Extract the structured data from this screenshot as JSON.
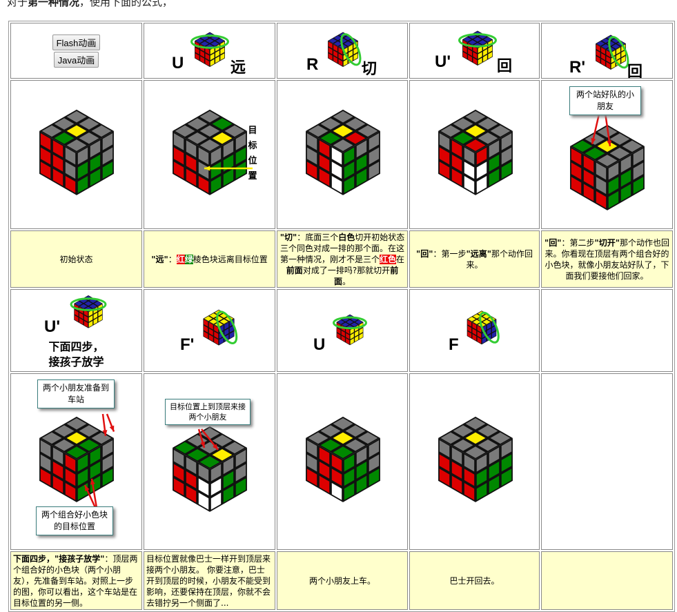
{
  "intro": {
    "prefix": "对于",
    "bold": "第一种情况",
    "suffix": "，使用下面的公式，"
  },
  "buttons": {
    "flash": "Flash动画",
    "java": "Java动画"
  },
  "moves_row1": [
    {
      "notation": "U",
      "label": "远"
    },
    {
      "notation": "R",
      "label": "切"
    },
    {
      "notation": "U'",
      "label": "回"
    },
    {
      "notation": "R'",
      "label": "回"
    }
  ],
  "moves_row4": {
    "first": {
      "notation": "U'",
      "title_line1": "下面四步，",
      "title_line2": "接孩子放学"
    },
    "others": [
      {
        "notation": "F'"
      },
      {
        "notation": "U"
      },
      {
        "notation": "F"
      }
    ]
  },
  "target_label": "目标位置",
  "callouts": {
    "kids_lined_up": "两个站好队的小朋友",
    "kids_to_station": "两个小朋友准备到车站",
    "target_of_pair": "两个组合好小色块的目标位置",
    "target_up": "目标位置上到顶层来接两个小朋友"
  },
  "captions_row3": [
    [
      {
        "t": "初始状态"
      }
    ],
    [
      {
        "t": "\"远\"",
        "b": 1
      },
      {
        "t": "："
      },
      {
        "t": "红",
        "hl": "r"
      },
      {
        "t": "绿",
        "hl": "g"
      },
      {
        "t": "棱色块远离目标位置"
      }
    ],
    [
      {
        "t": "\"切\"",
        "b": 1
      },
      {
        "t": "：底面三个"
      },
      {
        "t": "白色",
        "b": 1
      },
      {
        "t": "切开初始状态三个同色对成一排的那个面。在这第一种情况，刚才不是三个"
      },
      {
        "t": "红色",
        "hl": "r"
      },
      {
        "t": "在"
      },
      {
        "t": "前面",
        "b": 1
      },
      {
        "t": "对成了一排吗?那就切开"
      },
      {
        "t": "前面",
        "b": 1
      },
      {
        "t": "。"
      }
    ],
    [
      {
        "t": "\"回\"",
        "b": 1
      },
      {
        "t": "：第一步"
      },
      {
        "t": "\"远离\"",
        "b": 1
      },
      {
        "t": "那个动作回来。"
      }
    ],
    [
      {
        "t": "\"回\"",
        "b": 1
      },
      {
        "t": "：第二步"
      },
      {
        "t": "\"切开\"",
        "b": 1
      },
      {
        "t": "那个动作也回来。你看现在顶层有两个组合好的小色块，就像小朋友站好队了，下面我们要接他们回家。"
      }
    ]
  ],
  "captions_row6": [
    [
      {
        "t": "下面四步，\"接孩子放学\"",
        "b": 1
      },
      {
        "t": "：顶层两个组合好的小色块（两个小朋友），先准备到车站。对照上一步的图，你可以看出，这个车站是在目标位置的另一侧。"
      }
    ],
    [
      {
        "t": "目标位置就像巴士一样开到顶层来接两个小朋友。 你要注意，巴士开到顶层的时候，小朋友不能受到影响，还要保持在顶层，你就不会去错拧另一个侧面了..."
      }
    ],
    [
      {
        "t": "两个小朋友上车。"
      }
    ],
    [
      {
        "t": "巴士开回去。"
      }
    ],
    []
  ],
  "colors": {
    "g": "#7a7a7a",
    "Y": "#ffee00",
    "R": "#dd0000",
    "G": "#008800",
    "W": "#ffffff",
    "B": "#2222aa",
    "O": "#ff8800",
    "caption_bg": "#ffffcc",
    "arrow_green": "#33cc33"
  },
  "cubes": {
    "r2c1": {
      "top": "ggggYggGg",
      "left": "RRgRRgRRR",
      "right": "gggGGgGGG"
    },
    "r2c2": {
      "top": "gGgggYggg",
      "left": "gggRRgRRR",
      "right": "gggGGGGGG"
    },
    "r2c3": {
      "top": "ggggYRgGg",
      "left": "gRWgRWRRW",
      "right": "GggGGgGGg"
    },
    "r2c4": {
      "top": "ggggYggGR",
      "left": "gRgRRWRRW",
      "right": "RggWGgWGG"
    },
    "r2c5": {
      "top": "ggggYgGGg",
      "left": "RRgRRgRRR",
      "right": "gggGGgGGG"
    },
    "r5c1": {
      "top": "ggggYGggG",
      "left": "ggRgRRRRR",
      "right": "GGgGGgGGG"
    },
    "r5c2": {
      "top": "gggggYGGG",
      "left": "gggRRWRRW",
      "right": "gggWGgWGG"
    },
    "r5c3": {
      "top": "ggggYggGG",
      "left": "gRRgRRRRW",
      "right": "GggGGgGGG"
    },
    "r5c4": {
      "top": "ggggYgggg",
      "left": "gggRRRRRR",
      "right": "gggGGGGGG"
    },
    "thumb": {
      "top": "BBBBBBBBB",
      "left": "RRRRRRRRR",
      "right": "YYYYYYYYY"
    },
    "thumbF": {
      "top": "YYYYYYYYY",
      "left": "RRRRRRRRR",
      "right": "BBBBBBBBB"
    }
  }
}
